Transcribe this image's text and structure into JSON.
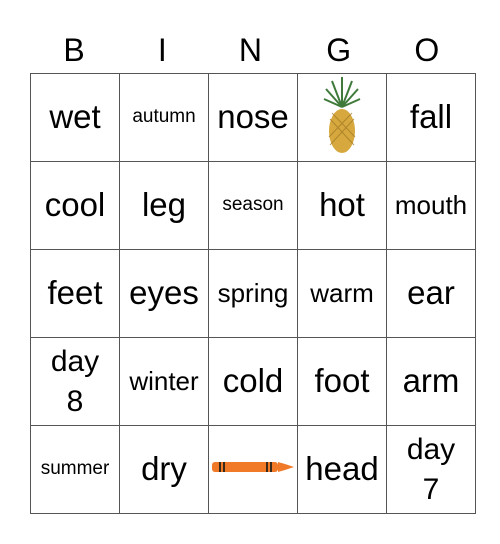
{
  "header": [
    "B",
    "I",
    "N",
    "G",
    "O"
  ],
  "rows": [
    [
      {
        "text": "wet",
        "size": "big"
      },
      {
        "text": "autumn",
        "size": "xs"
      },
      {
        "text": "nose",
        "size": "big"
      },
      {
        "icon": "pineapple-icon"
      },
      {
        "text": "fall",
        "size": "big"
      }
    ],
    [
      {
        "text": "cool",
        "size": "big"
      },
      {
        "text": "leg",
        "size": "big"
      },
      {
        "text": "season",
        "size": "xs"
      },
      {
        "text": "hot",
        "size": "big"
      },
      {
        "text": "mouth",
        "size": "mid"
      }
    ],
    [
      {
        "text": "feet",
        "size": "big"
      },
      {
        "text": "eyes",
        "size": "big"
      },
      {
        "text": "spring",
        "size": "mid"
      },
      {
        "text": "warm",
        "size": "mid"
      },
      {
        "text": "ear",
        "size": "big"
      }
    ],
    [
      {
        "text": "day 8",
        "size": "two"
      },
      {
        "text": "winter",
        "size": "mid"
      },
      {
        "text": "cold",
        "size": "big"
      },
      {
        "text": "foot",
        "size": "big"
      },
      {
        "text": "arm",
        "size": "big"
      }
    ],
    [
      {
        "text": "summer",
        "size": "xs"
      },
      {
        "text": "dry",
        "size": "big"
      },
      {
        "icon": "crayon-icon"
      },
      {
        "text": "head",
        "size": "big"
      },
      {
        "text": "day 7",
        "size": "two"
      }
    ]
  ]
}
